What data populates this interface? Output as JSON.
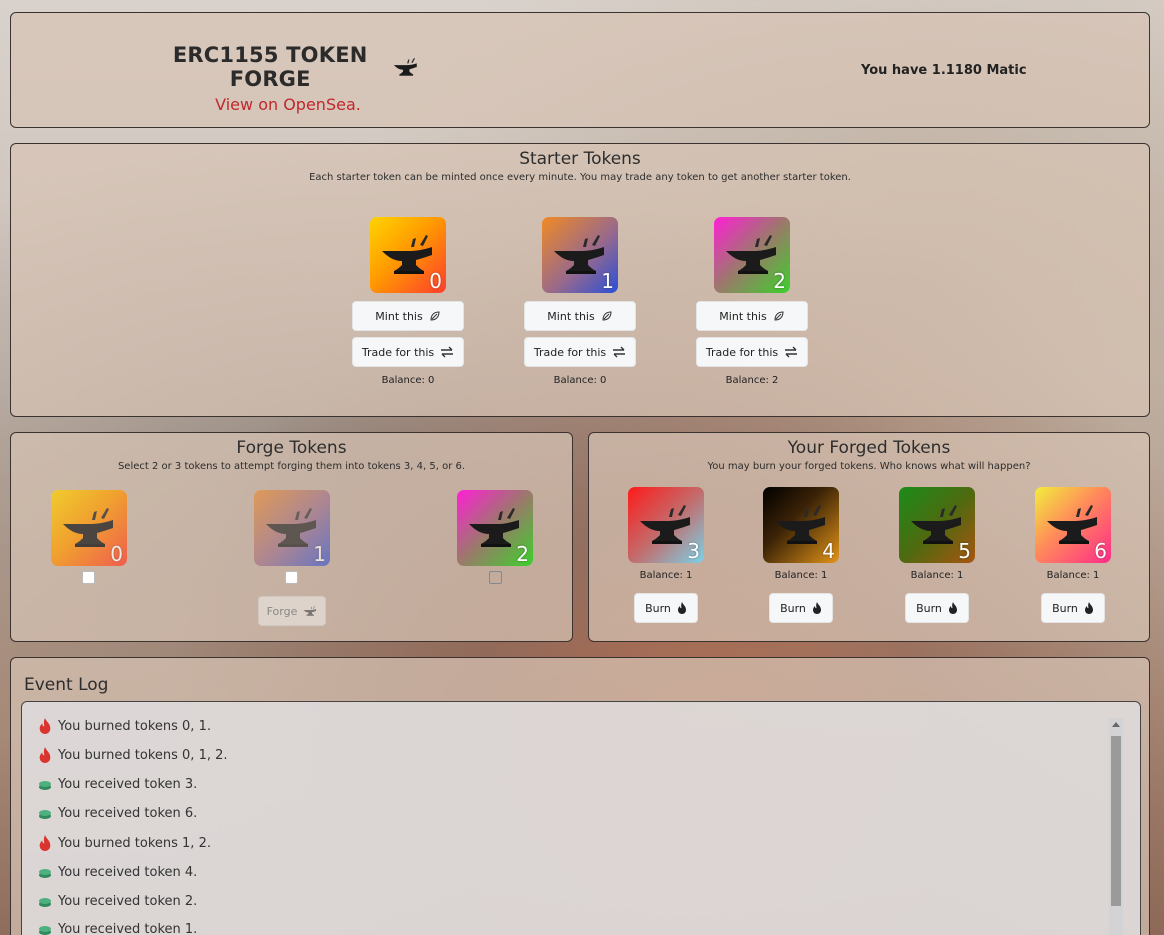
{
  "header": {
    "title": "ERC1155 TOKEN FORGE",
    "opensea_link": "View on OpenSea.",
    "balance_text": "You have 1.1180 Matic"
  },
  "starter": {
    "title": "Starter Tokens",
    "subtitle": "Each starter token can be minted once every minute. You may trade any token to get another starter token.",
    "tokens": [
      {
        "id": "0",
        "mint_label": "Mint this",
        "trade_label": "Trade for this",
        "balance": "Balance: 0"
      },
      {
        "id": "1",
        "mint_label": "Mint this",
        "trade_label": "Trade for this",
        "balance": "Balance: 0"
      },
      {
        "id": "2",
        "mint_label": "Mint this",
        "trade_label": "Trade for this",
        "balance": "Balance: 2"
      }
    ]
  },
  "forge": {
    "title": "Forge Tokens",
    "subtitle": "Select 2 or 3 tokens to attempt forging them into tokens 3, 4, 5, or 6.",
    "tokens": [
      "0",
      "1",
      "2"
    ],
    "forge_label": "Forge"
  },
  "forged": {
    "title": "Your Forged Tokens",
    "subtitle": "You may burn your forged tokens. Who knows what will happen?",
    "tokens": [
      {
        "id": "3",
        "balance": "Balance: 1",
        "burn_label": "Burn"
      },
      {
        "id": "4",
        "balance": "Balance: 1",
        "burn_label": "Burn"
      },
      {
        "id": "5",
        "balance": "Balance: 1",
        "burn_label": "Burn"
      },
      {
        "id": "6",
        "balance": "Balance: 1",
        "burn_label": "Burn"
      }
    ]
  },
  "log": {
    "title": "Event Log",
    "entries": [
      {
        "icon": "fire-icon",
        "text": "You burned tokens 0, 1."
      },
      {
        "icon": "fire-icon",
        "text": "You burned tokens 0, 1, 2."
      },
      {
        "icon": "coins-icon",
        "text": "You received token 3."
      },
      {
        "icon": "coins-icon",
        "text": "You received token 6."
      },
      {
        "icon": "fire-icon",
        "text": "You burned tokens 1, 2."
      },
      {
        "icon": "coins-icon",
        "text": "You received token 4."
      },
      {
        "icon": "coins-icon",
        "text": "You received token 2."
      },
      {
        "icon": "coins-icon",
        "text": "You received token 1."
      }
    ]
  },
  "colors": {
    "link": "#c0282d",
    "fire": "#d9352e",
    "coins": "#3a9c6a",
    "token_0": [
      "#ffd400",
      "#ff3d2e"
    ],
    "token_1": [
      "#f08a24",
      "#2b4fd8"
    ],
    "token_2": [
      "#ff1fd6",
      "#3bd12a"
    ],
    "token_3": [
      "#ff1a1a",
      "#7ad3e8"
    ],
    "token_4": [
      "#000000",
      "#e39419"
    ],
    "token_5": [
      "#1a8c1a",
      "#a8550f"
    ],
    "token_6": [
      "#f2ee3d",
      "#ff2b8a"
    ]
  }
}
